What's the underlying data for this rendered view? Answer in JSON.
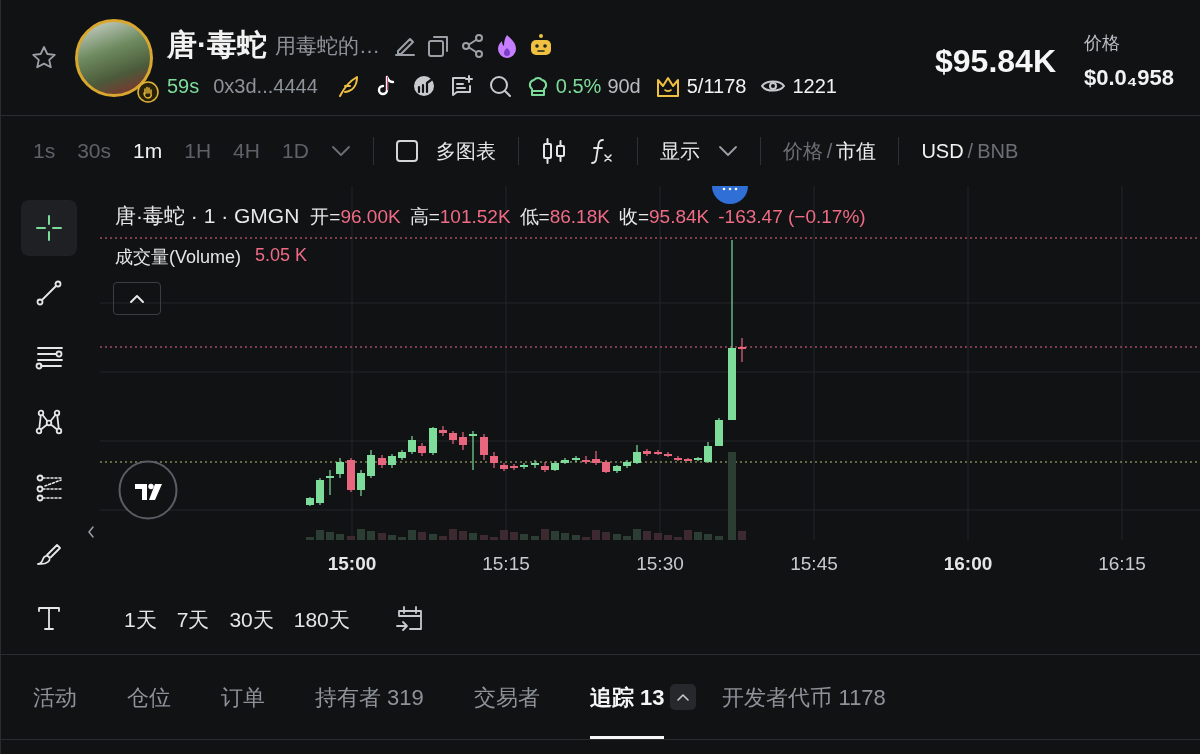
{
  "token": {
    "name": "唐·毒蛇",
    "description": "用毒蛇的…",
    "age": "59s",
    "address": "0x3d...4444",
    "holder_share": "0.5%",
    "period": "90d",
    "rank": "5/1178",
    "views": "1221",
    "market_cap": "$95.84K",
    "price_label": "价格",
    "price": "$0.0₄958"
  },
  "intervals": [
    {
      "label": "1s",
      "selected": false
    },
    {
      "label": "30s",
      "selected": false
    },
    {
      "label": "1m",
      "selected": true
    },
    {
      "label": "1H",
      "selected": false
    },
    {
      "label": "4H",
      "selected": false
    },
    {
      "label": "1D",
      "selected": false
    }
  ],
  "toolbar": {
    "multi_chart": {
      "label": "多图表",
      "checked": false
    },
    "display": "显示",
    "value_mode": {
      "separator": "/",
      "options": [
        {
          "label": "价格",
          "selected": false
        },
        {
          "label": "市值",
          "selected": true
        }
      ]
    },
    "currency": {
      "separator": "/",
      "options": [
        {
          "label": "USD",
          "selected": true
        },
        {
          "label": "BNB",
          "selected": false
        }
      ]
    }
  },
  "drawing_tools": [
    {
      "kind": "crosshair",
      "selected": true
    },
    {
      "kind": "trend-line",
      "selected": false
    },
    {
      "kind": "horizontal-lines",
      "selected": false
    },
    {
      "kind": "pattern",
      "selected": false
    },
    {
      "kind": "fork",
      "selected": false
    },
    {
      "kind": "brush",
      "selected": false
    },
    {
      "kind": "text",
      "selected": false
    }
  ],
  "legend": {
    "symbol": "唐·毒蛇 · 1 · GMGN",
    "fields": [
      {
        "label": "开=",
        "value": "96.00K"
      },
      {
        "label": "高=",
        "value": "101.52K"
      },
      {
        "label": "低=",
        "value": "86.18K"
      },
      {
        "label": "收=",
        "value": "95.84K"
      }
    ],
    "change": "-163.47 (−0.17%)"
  },
  "volume": {
    "label": "成交量(Volume)",
    "value": "5.05 K"
  },
  "time_axis": [
    {
      "label": "15:00",
      "major": true
    },
    {
      "label": "15:15",
      "major": false
    },
    {
      "label": "15:30",
      "major": false
    },
    {
      "label": "15:45",
      "major": false
    },
    {
      "label": "16:00",
      "major": true
    },
    {
      "label": "16:15",
      "major": false
    }
  ],
  "ranges": [
    "1天",
    "7天",
    "30天",
    "180天"
  ],
  "tabs": [
    {
      "label": "活动",
      "selected": false
    },
    {
      "label": "仓位",
      "selected": false
    },
    {
      "label": "订单",
      "selected": false
    },
    {
      "label": "持有者 319",
      "selected": false
    },
    {
      "label": "交易者",
      "selected": false
    },
    {
      "label": "追踪 13",
      "selected": true,
      "has_toggle": true
    },
    {
      "label": "开发者代币 1178",
      "selected": false
    }
  ]
}
